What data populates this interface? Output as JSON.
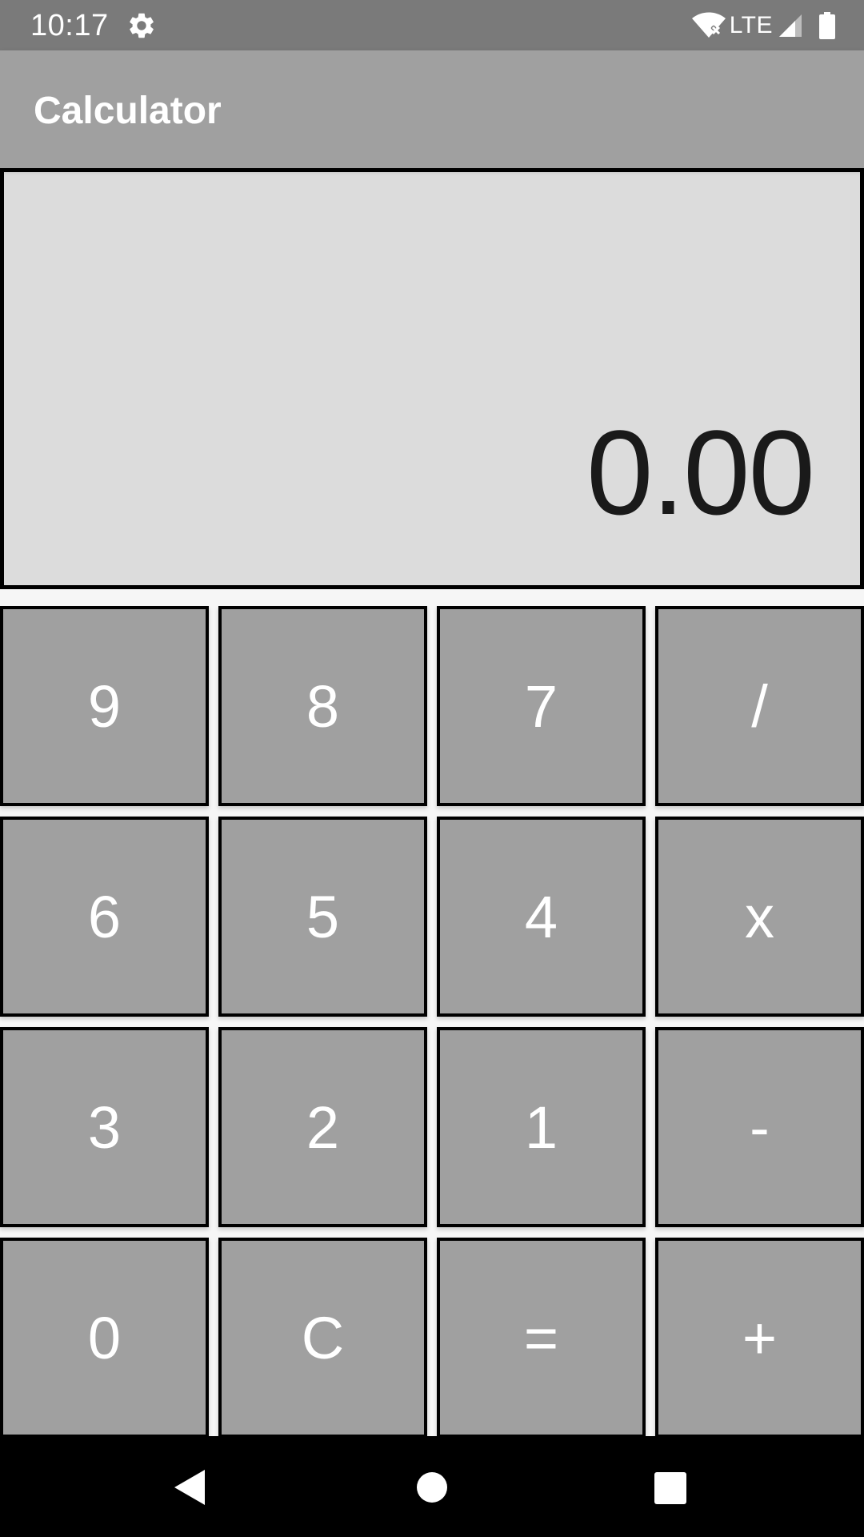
{
  "status_bar": {
    "time": "10:17",
    "network": "LTE",
    "icons": [
      "gear-icon",
      "wifi-icon",
      "signal-icon",
      "battery-icon"
    ]
  },
  "app_bar": {
    "title": "Calculator"
  },
  "display": {
    "value": "0.00"
  },
  "keypad": {
    "rows": [
      [
        "9",
        "8",
        "7",
        "/"
      ],
      [
        "6",
        "5",
        "4",
        "x"
      ],
      [
        "3",
        "2",
        "1",
        "-"
      ],
      [
        "0",
        "C",
        "=",
        "+"
      ]
    ]
  },
  "nav_bar": {
    "icons": [
      "back-icon",
      "home-icon",
      "recents-icon"
    ]
  },
  "colors": {
    "status_bar": "#7a7a7a",
    "app_bar": "#a0a0a0",
    "display_bg": "#dcdcdc",
    "key_bg": "#a0a0a0",
    "key_border": "#000000",
    "nav_bar": "#000000"
  }
}
